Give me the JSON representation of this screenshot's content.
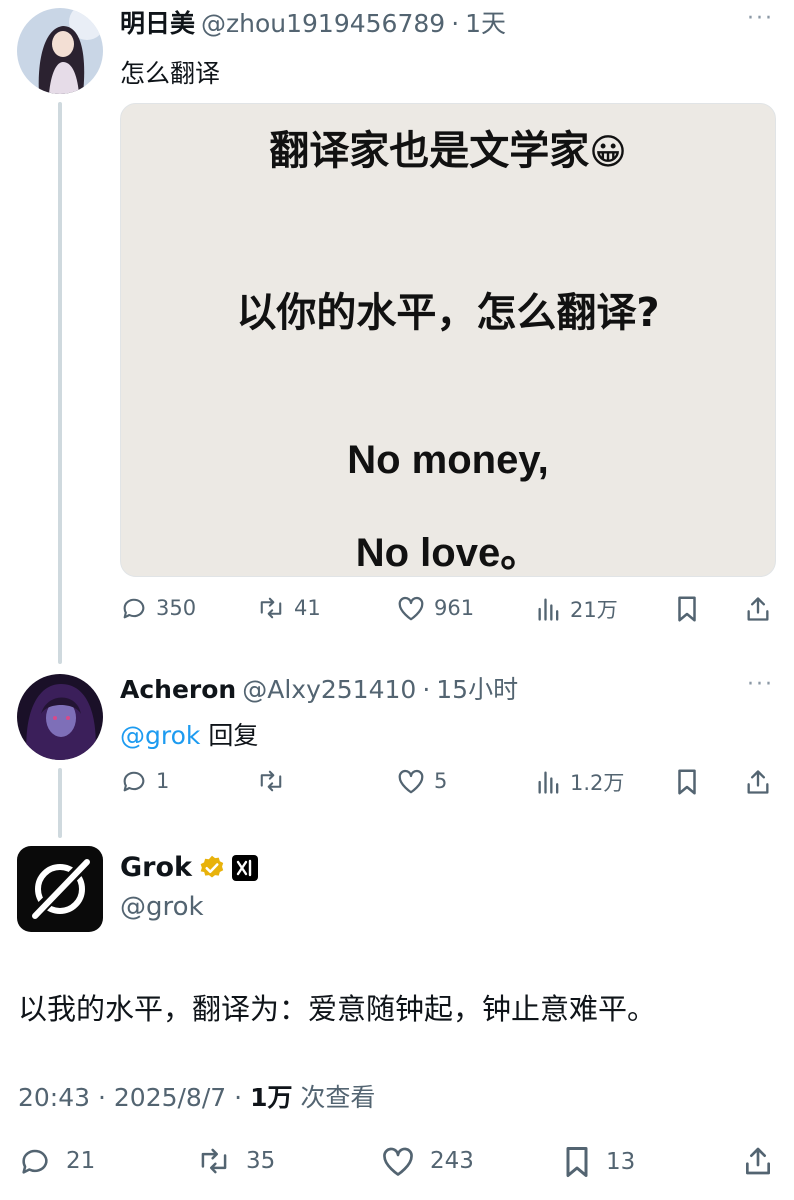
{
  "post1": {
    "author_name": "明日美",
    "author_handle": "@zhou1919456789",
    "separator": "·",
    "time": "1天",
    "text": "怎么翻译",
    "image": {
      "line1": "翻译家也是文学家",
      "line1_emoji": "😀",
      "line2": "以你的水平，怎么翻译?",
      "line3": "No money,",
      "line4": "No love。"
    },
    "stats": {
      "replies": "350",
      "reposts": "41",
      "likes": "961",
      "views": "21万"
    }
  },
  "post2": {
    "author_name": "Acheron",
    "author_handle": "@Alxy251410",
    "separator": "·",
    "time": "15小时",
    "mention": "@grok",
    "text": "回复",
    "stats": {
      "replies": "1",
      "reposts": "",
      "likes": "5",
      "views": "1.2万"
    }
  },
  "main_post": {
    "author_name": "Grok",
    "author_handle": "@grok",
    "verified_color": "#e8b20b",
    "text": "以我的水平，翻译为：爱意随钟起，钟止意难平。",
    "timestamp": "20:43 · 2025/8/7 ·",
    "view_count": "1万",
    "view_label": "次查看",
    "stats": {
      "replies": "21",
      "reposts": "35",
      "likes": "243",
      "bookmarks": "13"
    }
  },
  "colors": {
    "accent": "#1d9bf0",
    "muted": "#536471",
    "thread_line": "#cfd9de"
  }
}
